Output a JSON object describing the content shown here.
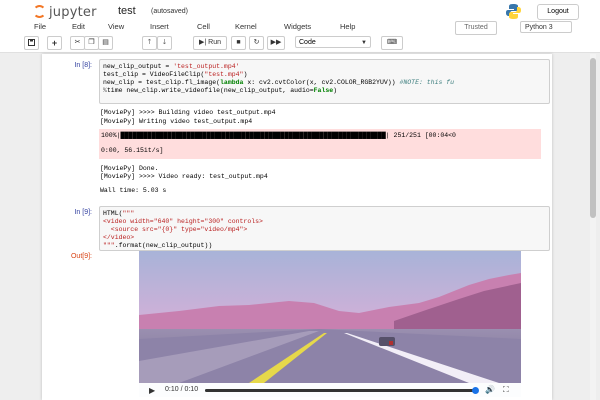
{
  "app": {
    "logo_text": "jupyter",
    "notebook_name": "test",
    "save_status": "(autosaved)",
    "logout_label": "Logout",
    "trusted_label": "Trusted",
    "kernel_label": "Python 3",
    "accent_color": "#f37726"
  },
  "menu": [
    "File",
    "Edit",
    "View",
    "Insert",
    "Cell",
    "Kernel",
    "Widgets",
    "Help"
  ],
  "toolbar": {
    "run_label": "Run",
    "cell_type": "Code",
    "icons": [
      "save-icon",
      "plus-icon",
      "cut-icon",
      "copy-icon",
      "paste-icon",
      "arrow-up-icon",
      "arrow-down-icon",
      "run-icon",
      "stop-icon",
      "restart-icon",
      "fast-forward-icon",
      "keyboard-icon"
    ]
  },
  "cells": {
    "cell8": {
      "prompt": "In [8]:",
      "output_lines": [
        "[MoviePy] >>>> Building video test_output.mp4",
        "[MoviePy] Writing video test_output.mp4"
      ],
      "progress_bar": "100%|████████████████████████████████████████████████████████████████████| 251/251 [00:04<0",
      "progress_tail": "0:00, 56.15it/s]",
      "progress_fraction": 1.0,
      "done_lines": [
        "[MoviePy] Done.",
        "[MoviePy] >>>> Video ready: test_output.mp4"
      ],
      "wall_time": "Wall time: 5.03 s"
    },
    "cell9": {
      "prompt": "In [9]:",
      "out_prompt": "Out[9]:"
    }
  },
  "video": {
    "time": "0:10 / 0:10",
    "progress_fraction": 1.0
  }
}
